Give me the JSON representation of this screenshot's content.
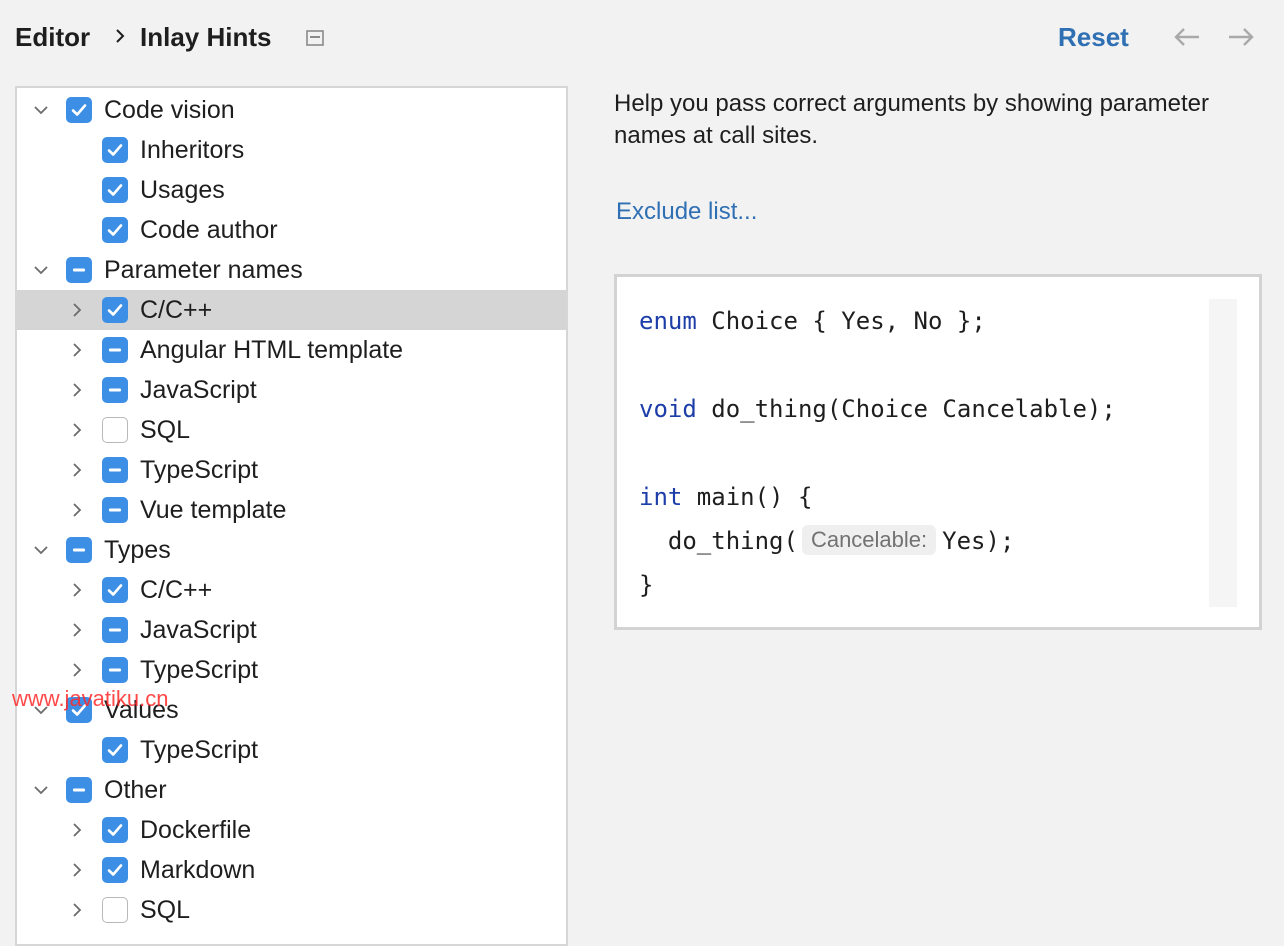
{
  "header": {
    "breadcrumb": [
      "Editor",
      "Inlay Hints"
    ],
    "reset_label": "Reset"
  },
  "tree": [
    {
      "label": "Code vision",
      "state": "checked",
      "level": 0,
      "chevron": "down"
    },
    {
      "label": "Inheritors",
      "state": "checked",
      "level": 1,
      "chevron": "none"
    },
    {
      "label": "Usages",
      "state": "checked",
      "level": 1,
      "chevron": "none"
    },
    {
      "label": "Code author",
      "state": "checked",
      "level": 1,
      "chevron": "none"
    },
    {
      "label": "Parameter names",
      "state": "partial",
      "level": 0,
      "chevron": "down"
    },
    {
      "label": "C/C++",
      "state": "checked",
      "level": 1,
      "chevron": "right",
      "selected": true
    },
    {
      "label": "Angular HTML template",
      "state": "partial",
      "level": 1,
      "chevron": "right"
    },
    {
      "label": "JavaScript",
      "state": "partial",
      "level": 1,
      "chevron": "right"
    },
    {
      "label": "SQL",
      "state": "unchecked",
      "level": 1,
      "chevron": "right"
    },
    {
      "label": "TypeScript",
      "state": "partial",
      "level": 1,
      "chevron": "right"
    },
    {
      "label": "Vue template",
      "state": "partial",
      "level": 1,
      "chevron": "right"
    },
    {
      "label": "Types",
      "state": "partial",
      "level": 0,
      "chevron": "down"
    },
    {
      "label": "C/C++",
      "state": "checked",
      "level": 1,
      "chevron": "right"
    },
    {
      "label": "JavaScript",
      "state": "partial",
      "level": 1,
      "chevron": "right"
    },
    {
      "label": "TypeScript",
      "state": "partial",
      "level": 1,
      "chevron": "right"
    },
    {
      "label": "Values",
      "state": "checked",
      "level": 0,
      "chevron": "down"
    },
    {
      "label": "TypeScript",
      "state": "checked",
      "level": 1,
      "chevron": "none"
    },
    {
      "label": "Other",
      "state": "partial",
      "level": 0,
      "chevron": "down"
    },
    {
      "label": "Dockerfile",
      "state": "checked",
      "level": 1,
      "chevron": "right"
    },
    {
      "label": "Markdown",
      "state": "checked",
      "level": 1,
      "chevron": "right"
    },
    {
      "label": "SQL",
      "state": "unchecked",
      "level": 1,
      "chevron": "right"
    }
  ],
  "description": "Help you pass correct arguments by showing parameter names at call sites.",
  "exclude_link": "Exclude list...",
  "code": {
    "line1_kw": "enum",
    "line1_rest": " Choice { Yes, No };",
    "line2_kw": "void",
    "line2_rest": " do_thing(Choice Cancelable);",
    "line3_kw": "int",
    "line3_rest": " main() {",
    "line4_pre": "  do_thing(",
    "line4_hint": "Cancelable:",
    "line4_post": "Yes);",
    "line5": "}"
  },
  "watermark": "www.javatiku.cn",
  "colors": {
    "accent": "#3d8fe6",
    "link": "#2f6fb3",
    "keyword": "#1d3ea8",
    "selection": "#d5d5d5"
  }
}
